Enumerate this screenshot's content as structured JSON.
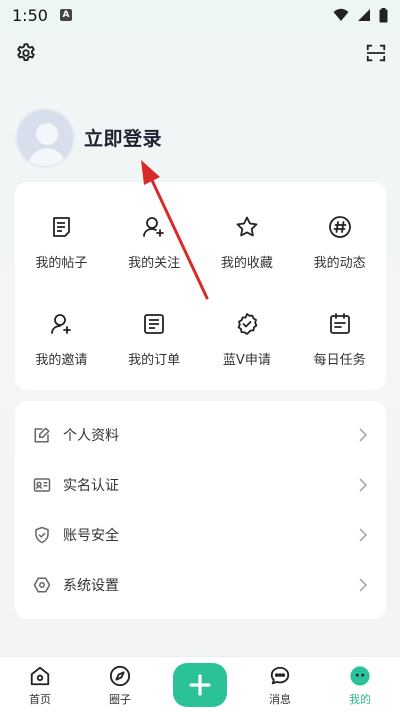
{
  "status_bar": {
    "time": "1:50",
    "badge": "A"
  },
  "profile": {
    "login_text": "立即登录"
  },
  "features": [
    {
      "label": "我的帖子",
      "icon": "note-icon"
    },
    {
      "label": "我的关注",
      "icon": "user-plus-icon"
    },
    {
      "label": "我的收藏",
      "icon": "star-icon"
    },
    {
      "label": "我的动态",
      "icon": "hashtag-icon"
    },
    {
      "label": "我的邀请",
      "icon": "user-add-icon"
    },
    {
      "label": "我的订单",
      "icon": "order-icon"
    },
    {
      "label": "蓝V申请",
      "icon": "verified-badge-icon"
    },
    {
      "label": "每日任务",
      "icon": "calendar-icon"
    }
  ],
  "menu": [
    {
      "label": "个人资料",
      "icon": "edit-profile-icon"
    },
    {
      "label": "实名认证",
      "icon": "id-card-icon"
    },
    {
      "label": "账号安全",
      "icon": "shield-icon"
    },
    {
      "label": "系统设置",
      "icon": "settings-hex-icon"
    }
  ],
  "bottom_nav": [
    {
      "label": "首页",
      "icon": "home-icon"
    },
    {
      "label": "圈子",
      "icon": "compass-icon"
    },
    {
      "label": "",
      "icon": "plus-icon"
    },
    {
      "label": "消息",
      "icon": "chat-icon"
    },
    {
      "label": "我的",
      "icon": "profile-face-icon",
      "active": true
    }
  ],
  "colors": {
    "accent": "#2bc29a",
    "active_text": "#2bb48d",
    "annotation": "#d92a2a"
  }
}
